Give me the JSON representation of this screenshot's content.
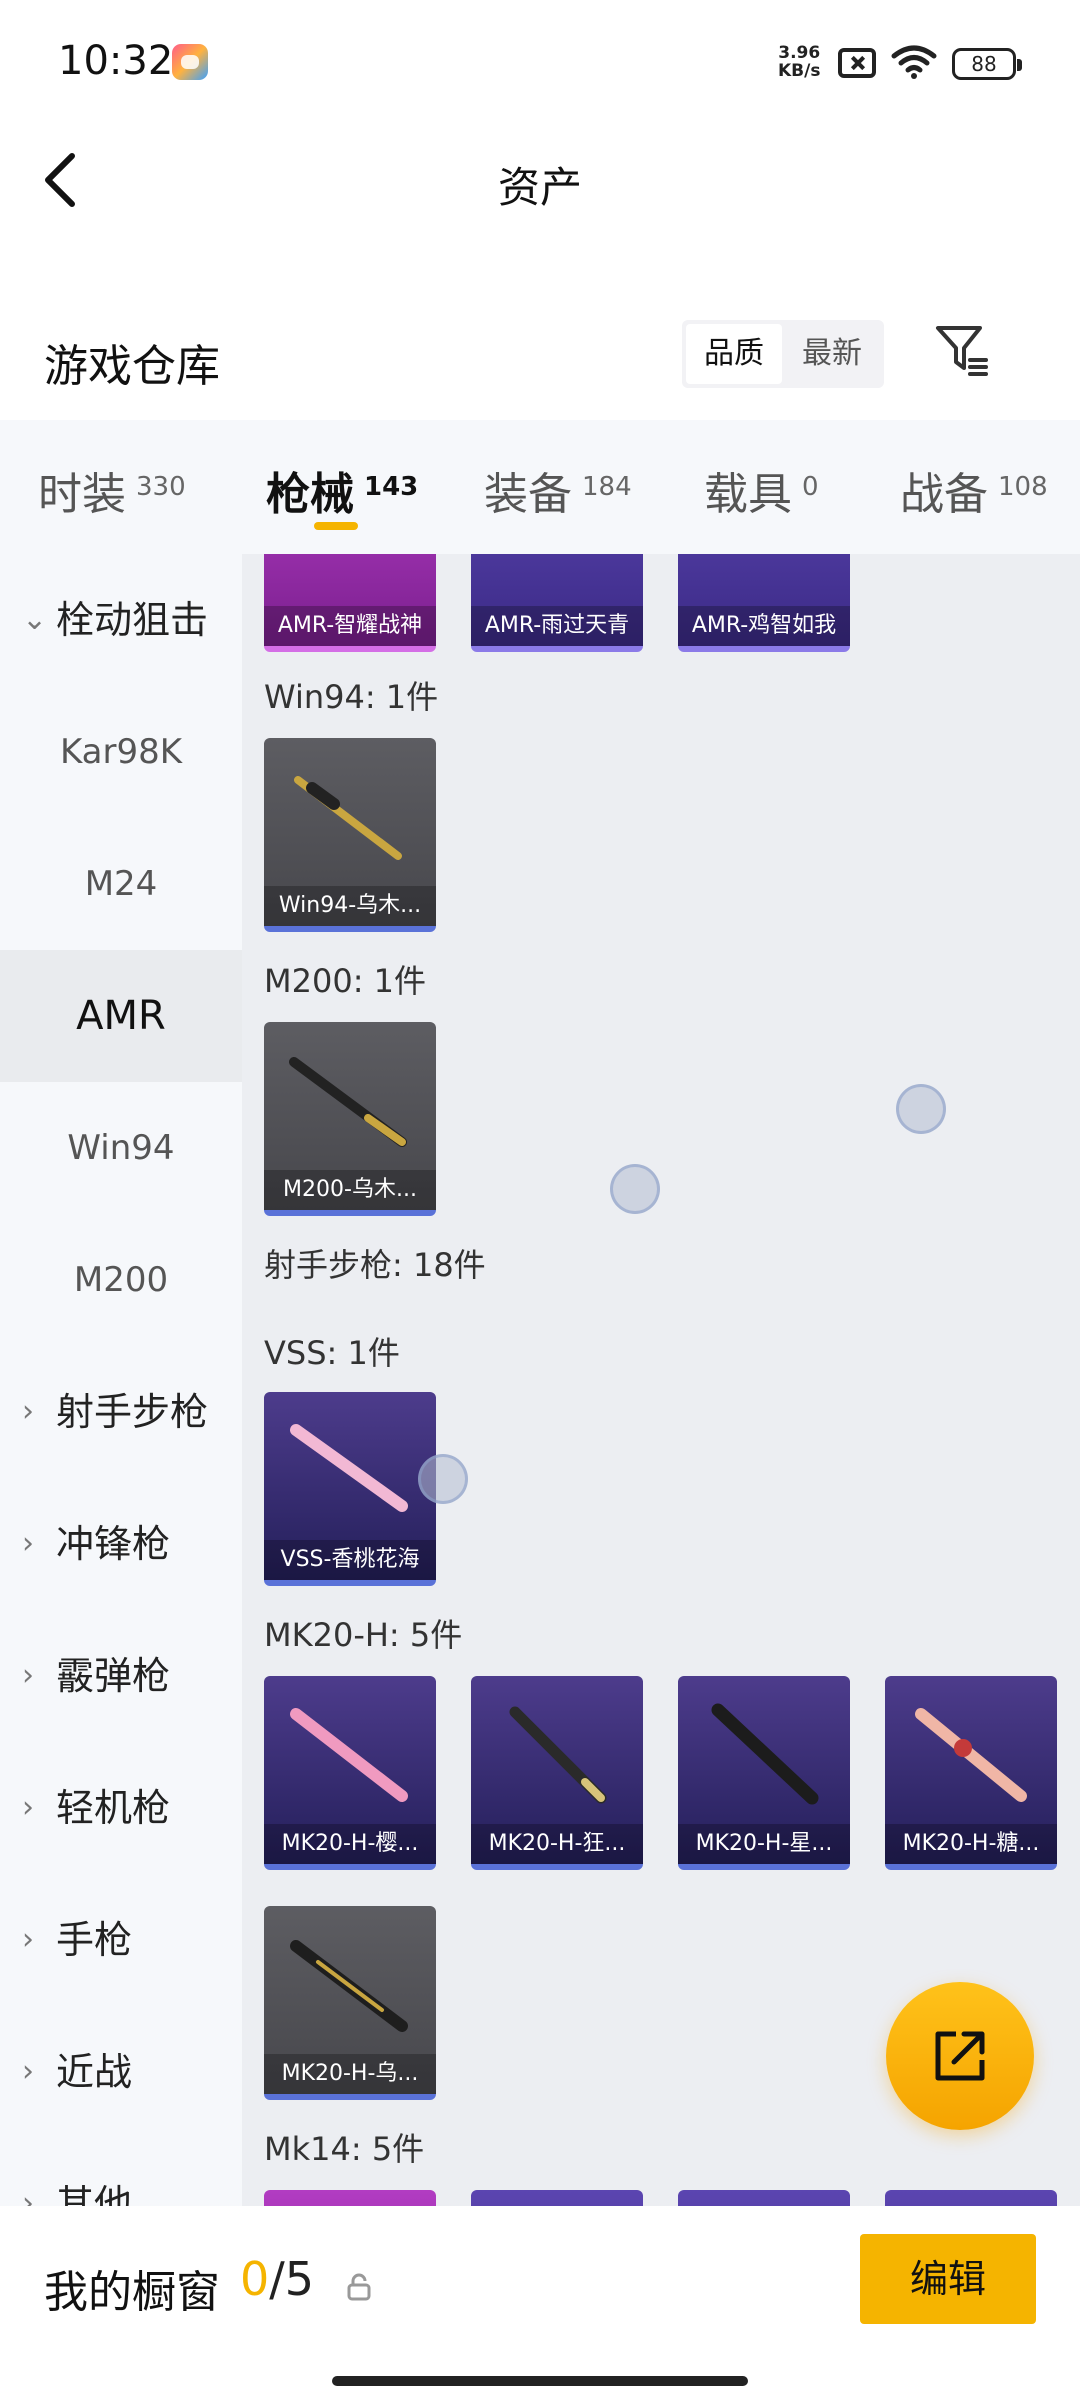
{
  "status": {
    "time": "10:32",
    "net_speed_top": "3.96",
    "net_speed_bottom": "KB/s",
    "battery": "88"
  },
  "header": {
    "title": "资产"
  },
  "warehouse": {
    "title": "游戏仓库",
    "sort_options": [
      "品质",
      "最新"
    ],
    "active_sort": "品质"
  },
  "tabs": [
    {
      "name": "时装",
      "count": "330"
    },
    {
      "name": "枪械",
      "count": "143"
    },
    {
      "name": "装备",
      "count": "184"
    },
    {
      "name": "载具",
      "count": "0"
    },
    {
      "name": "战备",
      "count": "108"
    }
  ],
  "sidebar": [
    {
      "label": "栓动狙击",
      "kind": "group",
      "expanded": true
    },
    {
      "label": "Kar98K",
      "kind": "sub"
    },
    {
      "label": "M24",
      "kind": "sub"
    },
    {
      "label": "AMR",
      "kind": "sub",
      "active": true
    },
    {
      "label": "Win94",
      "kind": "sub"
    },
    {
      "label": "M200",
      "kind": "sub"
    },
    {
      "label": "射手步枪",
      "kind": "group"
    },
    {
      "label": "冲锋枪",
      "kind": "group"
    },
    {
      "label": "霰弹枪",
      "kind": "group"
    },
    {
      "label": "轻机枪",
      "kind": "group"
    },
    {
      "label": "手枪",
      "kind": "group"
    },
    {
      "label": "近战",
      "kind": "group"
    },
    {
      "label": "其他",
      "kind": "group"
    }
  ],
  "content": {
    "amr_items": [
      "AMR-智耀战神",
      "AMR-雨过天青",
      "AMR-鸡智如我"
    ],
    "win94": {
      "title": "Win94: 1件",
      "items": [
        "Win94-乌木..."
      ]
    },
    "m200": {
      "title": "M200: 1件",
      "items": [
        "M200-乌木..."
      ]
    },
    "dmr_header": "射手步枪: 18件",
    "vss": {
      "title": "VSS: 1件",
      "items": [
        "VSS-香桃花海"
      ]
    },
    "mk20": {
      "title": "MK20-H: 5件",
      "items": [
        "MK20-H-樱...",
        "MK20-H-狂...",
        "MK20-H-星...",
        "MK20-H-糖...",
        "MK20-H-乌..."
      ]
    },
    "mk14": {
      "title": "Mk14: 5件"
    }
  },
  "bottom": {
    "label": "我的橱窗",
    "current": "0",
    "separator": "/",
    "total": "5",
    "edit": "编辑"
  },
  "colors": {
    "accent": "#f5b400",
    "page_bg": "#eceef2",
    "nav_bg": "#f6f8fb"
  }
}
